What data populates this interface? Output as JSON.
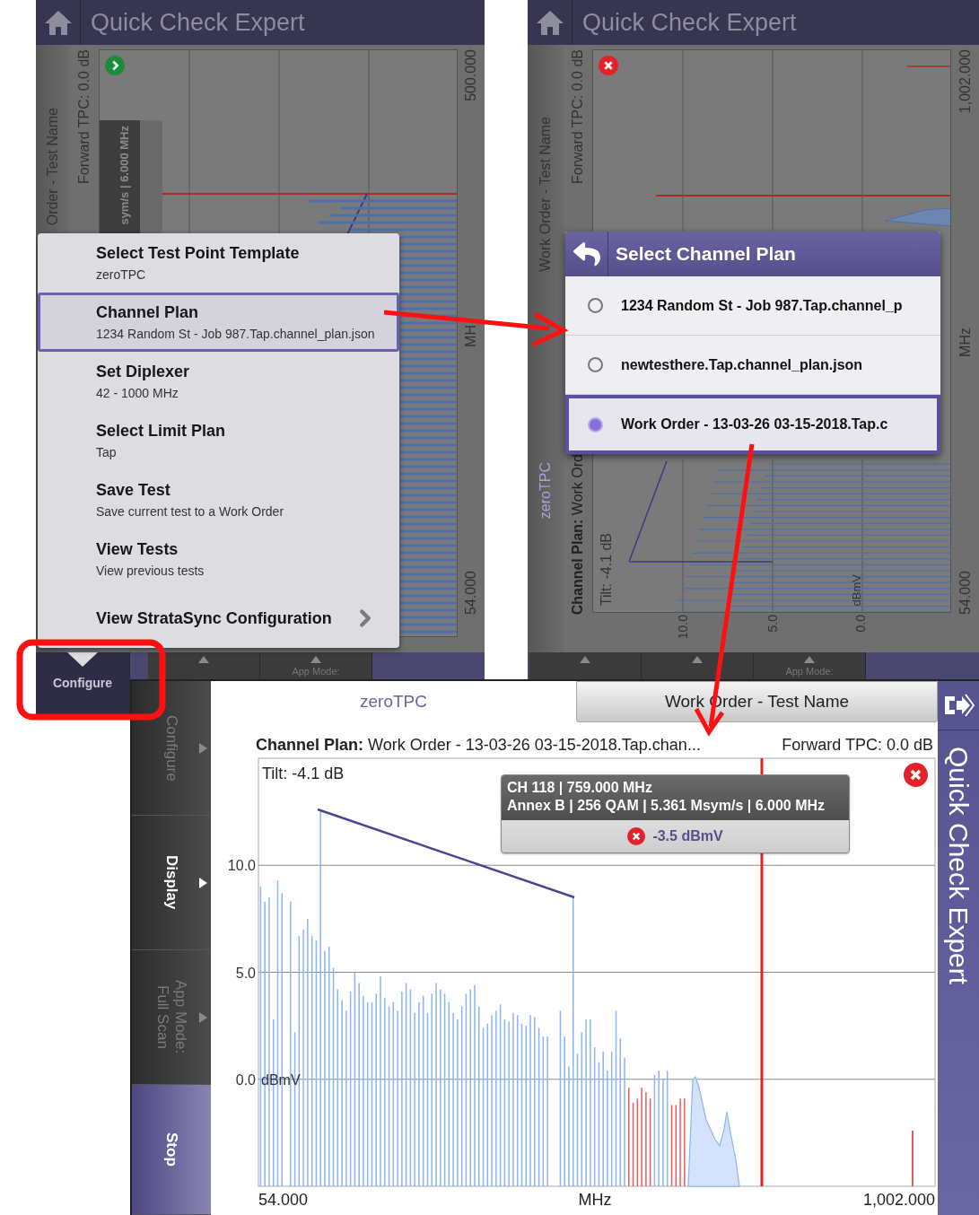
{
  "menu_screen": {
    "header": {
      "title": "Quick Check Expert"
    },
    "background": {
      "test_name": "Order - Test Name",
      "forward_tpc": "Forward TPC: 0.0 dB",
      "passed": true,
      "tooltip": "sym/s | 6.000 MHz",
      "axis_labels": [
        "500.000",
        "MH",
        "54.000"
      ]
    },
    "menu": [
      {
        "kind": "setting",
        "title": "Select Test Point Template",
        "subtitle": "zeroTPC",
        "selected": false
      },
      {
        "kind": "setting",
        "title": "Channel Plan",
        "subtitle": "1234 Random St - Job 987.Tap.channel_plan.json",
        "selected": true
      },
      {
        "kind": "setting",
        "title": "Set Diplexer",
        "subtitle": "42 - 1000 MHz",
        "selected": false
      },
      {
        "kind": "setting",
        "title": "Select Limit Plan",
        "subtitle": "Tap",
        "selected": false
      },
      {
        "kind": "setting",
        "title": "Save Test",
        "subtitle": "Save current test to a Work Order",
        "selected": false
      },
      {
        "kind": "setting",
        "title": "View Tests",
        "subtitle": "View previous tests",
        "selected": false
      },
      {
        "kind": "submenu",
        "title": "View StrataSync Configuration",
        "selected": false
      }
    ],
    "bottom_bar": [
      {
        "label": "Configure",
        "selected": true
      },
      {
        "selected": false
      },
      {
        "label": "App Mode:",
        "selected": false
      }
    ]
  },
  "channel_plan_screen": {
    "header": {
      "title": "Quick Check Expert"
    },
    "background": {
      "test_name": "Work Order - Test Name",
      "template": "zeroTPC",
      "forward_tpc": "Forward TPC: 0.0 dB",
      "channel_plan": "**Channel Plan:** Work Ord",
      "tilt": "Tilt: -4.1 dB",
      "passed": false,
      "y_ticks": [
        "10.0",
        "5.0",
        "0.0"
      ],
      "unit": "dBmV",
      "axis_labels": [
        "1,002.000",
        "MHz",
        "54.000"
      ]
    },
    "dialog": {
      "title": "Select Channel Plan",
      "options": [
        {
          "label": "1234 Random St - Job 987.Tap.channel_p",
          "selected": false
        },
        {
          "label": "newtesthere.Tap.channel_plan.json",
          "selected": false
        },
        {
          "label": "Work Order - 13-03-26 03-15-2018.Tap.c",
          "selected": true
        }
      ]
    },
    "bottom_bar": [
      {
        "selected": false
      },
      {
        "selected": false
      },
      {
        "label": "App Mode:",
        "selected": false
      }
    ]
  },
  "spectrum_screen": {
    "sidebar": [
      {
        "kind": "menu",
        "label": "Configure",
        "selected": false
      },
      {
        "kind": "menu",
        "label": "Display",
        "selected": true
      },
      {
        "kind": "menu",
        "label": "App Mode:",
        "value": "Full Scan",
        "selected": false
      },
      {
        "kind": "action",
        "label": "Stop"
      }
    ],
    "tabs": [
      {
        "label": "zeroTPC",
        "selected": true
      },
      {
        "label": "Work Order - Test Name",
        "selected": false
      }
    ],
    "channel_plan": "**Channel Plan:** Work Order - 13-03-26 03-15-2018.Tap.chan...",
    "forward_tpc": "Forward TPC: 0.0 dB",
    "passed": false,
    "tooltip": {
      "line_1": "CH 118 | 759.000 MHz",
      "line_2": "Annex B | 256 QAM | 5.361 Msym/s | 6.000 MHz",
      "reading": "-3.5 dBmV",
      "passed": false
    },
    "chart": {
      "tilt": "Tilt: -4.1 dB",
      "y_ticks": [
        "10.0",
        "5.0",
        "0.0"
      ],
      "y_unit": "dBmV",
      "x_labels": [
        "54.000",
        "MHz",
        "1,002.000"
      ]
    },
    "side_title": "Quick Check Expert"
  }
}
